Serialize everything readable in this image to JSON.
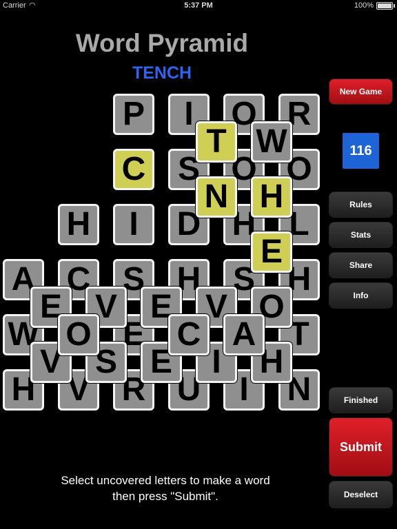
{
  "status_bar": {
    "carrier": "Carrier",
    "time": "5:37 PM",
    "battery": "100%"
  },
  "title": "Word Pyramid",
  "current_word": "TENCH",
  "buttons": {
    "new_game": "New Game",
    "rules": "Rules",
    "stats": "Stats",
    "share": "Share",
    "info": "Info",
    "finished": "Finished",
    "submit": "Submit",
    "deselect": "Deselect"
  },
  "score": "116",
  "instructions": {
    "line1": "Select uncovered letters to make a word",
    "line2": "then press \"Submit\"."
  },
  "tiles": [
    {
      "letter": "P",
      "selected": false
    },
    {
      "letter": "I",
      "selected": false
    },
    {
      "letter": "O",
      "selected": false
    },
    {
      "letter": "R",
      "selected": false
    },
    {
      "letter": "C",
      "selected": true
    },
    {
      "letter": "S",
      "selected": false
    },
    {
      "letter": "O",
      "selected": false
    },
    {
      "letter": "O",
      "selected": false
    },
    {
      "letter": "H",
      "selected": false
    },
    {
      "letter": "I",
      "selected": false
    },
    {
      "letter": "D",
      "selected": false
    },
    {
      "letter": "H",
      "selected": false
    },
    {
      "letter": "L",
      "selected": false
    },
    {
      "letter": "A",
      "selected": false
    },
    {
      "letter": "C",
      "selected": false
    },
    {
      "letter": "S",
      "selected": false
    },
    {
      "letter": "H",
      "selected": false
    },
    {
      "letter": "S",
      "selected": false
    },
    {
      "letter": "H",
      "selected": false
    },
    {
      "letter": "W",
      "selected": false
    },
    {
      "letter": "O",
      "selected": false
    },
    {
      "letter": "E",
      "selected": false
    },
    {
      "letter": "C",
      "selected": false
    },
    {
      "letter": "A",
      "selected": false
    },
    {
      "letter": "C",
      "selected": false
    },
    {
      "letter": "T",
      "selected": false
    },
    {
      "letter": "H",
      "selected": false
    },
    {
      "letter": "V",
      "selected": false
    },
    {
      "letter": "R",
      "selected": false
    },
    {
      "letter": "U",
      "selected": false
    },
    {
      "letter": "I",
      "selected": false
    },
    {
      "letter": "N",
      "selected": false
    },
    {
      "letter": "V",
      "selected": false
    },
    {
      "letter": "S",
      "selected": false
    },
    {
      "letter": "E",
      "selected": false
    },
    {
      "letter": "I",
      "selected": false
    },
    {
      "letter": "H",
      "selected": false
    },
    {
      "letter": "E",
      "selected": false
    },
    {
      "letter": "V",
      "selected": false
    },
    {
      "letter": "E",
      "selected": false
    },
    {
      "letter": "V",
      "selected": false
    },
    {
      "letter": "O",
      "selected": false
    },
    {
      "letter": "O",
      "selected": false
    },
    {
      "letter": "C",
      "selected": false
    },
    {
      "letter": "A",
      "selected": false
    },
    {
      "letter": "T",
      "selected": true
    },
    {
      "letter": "W",
      "selected": false
    },
    {
      "letter": "N",
      "selected": true
    },
    {
      "letter": "H",
      "selected": true
    },
    {
      "letter": "E",
      "selected": true
    }
  ]
}
